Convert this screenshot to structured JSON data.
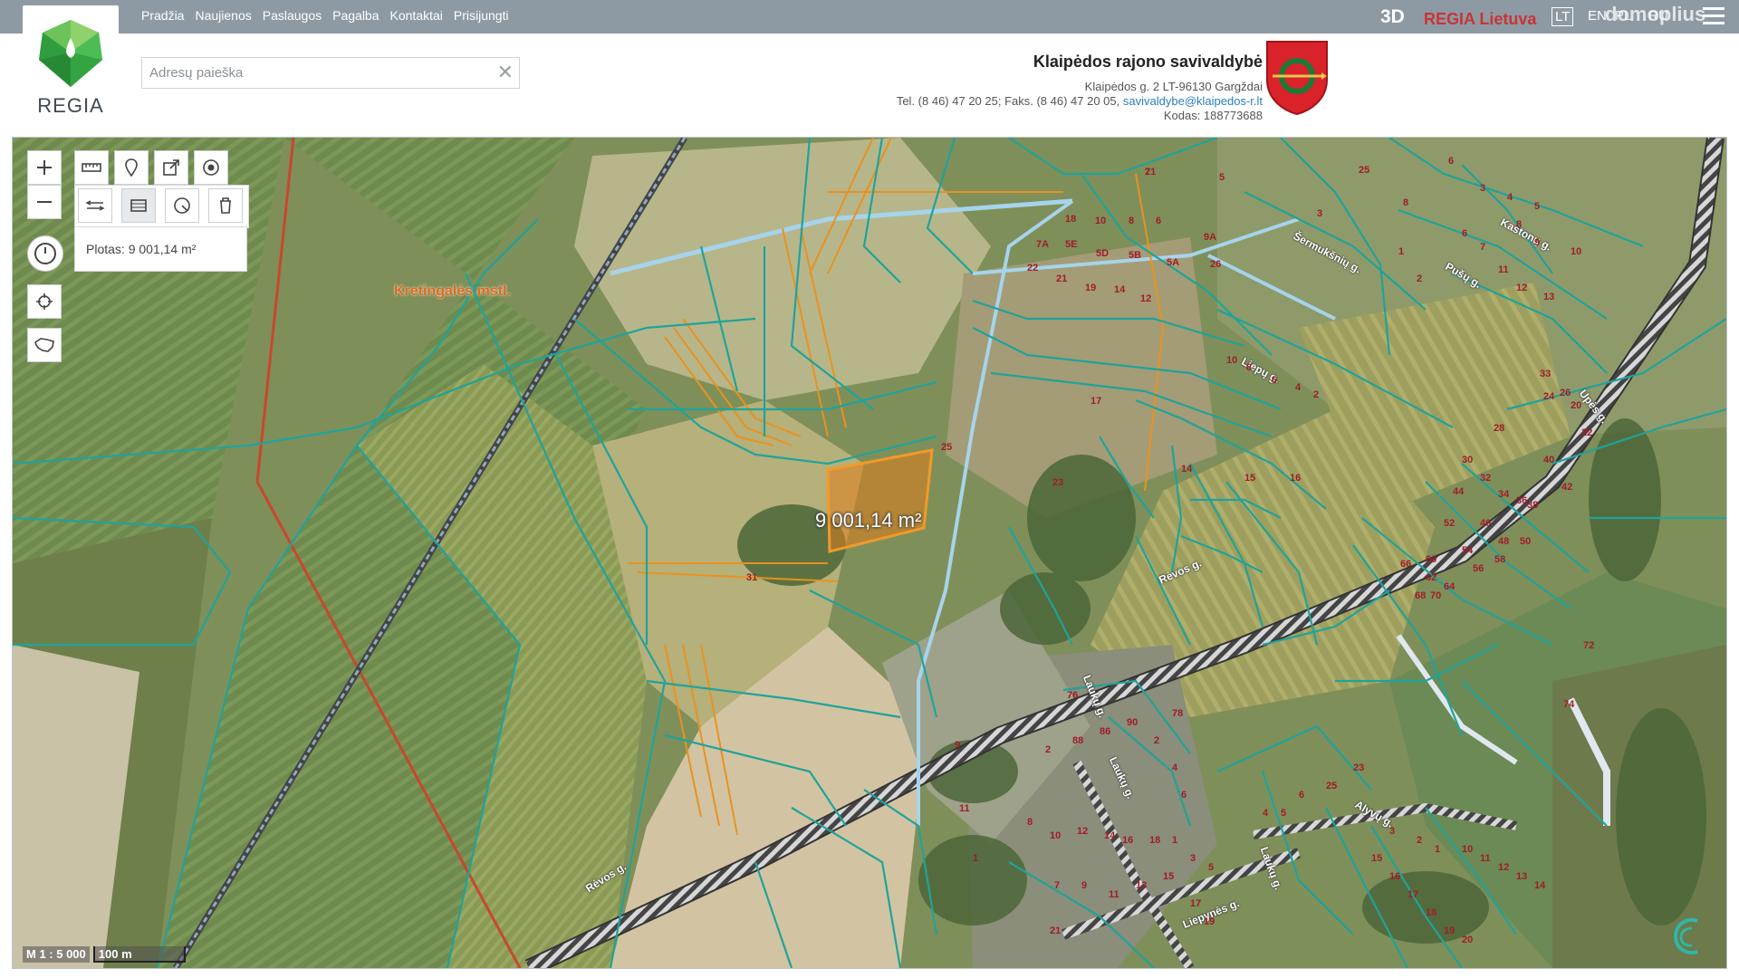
{
  "nav": {
    "items": [
      "Pradžia",
      "Naujienos",
      "Paslaugos",
      "Pagalba",
      "Kontaktai",
      "Prisijungti"
    ]
  },
  "top_right": {
    "btn_3d": "3D",
    "regia_lietuva": "REGIA Lietuva",
    "lang_lt": "LT",
    "lang_en": "EN",
    "lang_pl": "PL",
    "lang_ru": "RU",
    "watermark": "domoplius"
  },
  "logo": {
    "text": "REGIA"
  },
  "search": {
    "placeholder": "Adresų paieška",
    "value": ""
  },
  "municipality": {
    "name": "Klaipėdos rajono savivaldybė",
    "address": "Klaipėdos g. 2 LT-96130 Gargždai",
    "phone": "Tel. (8 46) 47 20 25; Faks. (8 46) 47 20 05,",
    "email": "savivaldybe@klaipedos-r.lt",
    "code": "Kodas: 188773688"
  },
  "map": {
    "town": "Kretingalės mstl.",
    "measured_area": "9 001,14 m²",
    "plotas": "Plotas: 9 001,14 m²",
    "scale_ratio": "M 1 : 5 000",
    "scale_length": "100 m",
    "streets": [
      "Šermukšnių g.",
      "Kaštonų g.",
      "Pušų g.",
      "Liepų g.",
      "Upės g.",
      "Rėvos g.",
      "Rėvos g.",
      "Laukų g.",
      "Laukų g.",
      "Laukų g.",
      "Liepynės g.",
      "Alyvų g."
    ],
    "parcel_numbers": [
      "7",
      "5",
      "25",
      "6",
      "3",
      "8",
      "18",
      "10",
      "8",
      "6",
      "9A",
      "7A",
      "5E",
      "5D",
      "5B",
      "5A",
      "26",
      "22",
      "21",
      "19",
      "14",
      "12",
      "10",
      "8",
      "6",
      "4",
      "2",
      "1",
      "2",
      "3",
      "4",
      "5",
      "6",
      "7",
      "8",
      "9",
      "10",
      "11",
      "12",
      "13",
      "14",
      "15",
      "16",
      "17",
      "23",
      "25",
      "31",
      "33",
      "20",
      "22",
      "24",
      "26",
      "28",
      "30",
      "32",
      "34",
      "36",
      "38",
      "40",
      "42",
      "44",
      "46",
      "48",
      "50",
      "52",
      "54",
      "56",
      "58",
      "60",
      "62",
      "64",
      "66",
      "68",
      "70",
      "72",
      "74",
      "76",
      "78",
      "9",
      "11",
      "1",
      "2",
      "88",
      "86",
      "90",
      "2",
      "4",
      "6",
      "8",
      "10",
      "12",
      "14",
      "16",
      "18",
      "1",
      "3",
      "5",
      "7",
      "9",
      "11",
      "13",
      "15",
      "17",
      "19",
      "21",
      "23",
      "25",
      "6",
      "5",
      "4",
      "3",
      "2",
      "1",
      "10",
      "11",
      "12",
      "13",
      "14",
      "15",
      "16",
      "17",
      "18",
      "19",
      "20",
      "21"
    ],
    "colors": {
      "parcel": "#1fa39a",
      "parcel_highlight": "#e8921f",
      "boundary_red": "#c8472e",
      "road_stripe": "#cfcfcf",
      "selection": "#e8921f"
    }
  },
  "tools": {
    "zoom_in": "zoom-in-icon",
    "zoom_out": "zoom-out-icon",
    "measure": "ruler-icon",
    "pin": "pin-icon",
    "export": "export-icon",
    "target": "target-icon",
    "history": "clock-icon",
    "locate": "crosshair-icon",
    "lithuania": "lithuania-map-icon"
  }
}
